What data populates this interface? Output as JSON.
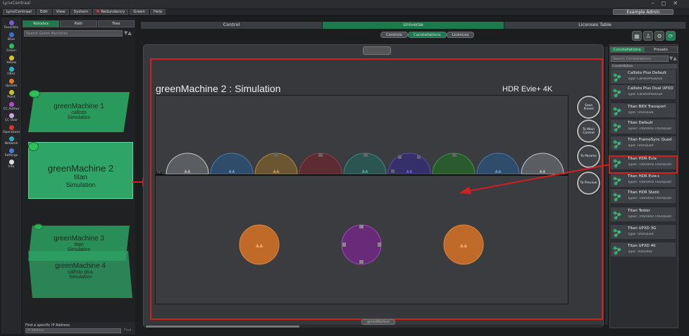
{
  "app": {
    "title": "LynxCentraal"
  },
  "menu": {
    "items": [
      "LynxCentraal",
      "Edit",
      "View",
      "System",
      "Redundancy",
      "Green",
      "Help"
    ],
    "user": "Example Admin"
  },
  "rail": {
    "items": [
      {
        "label": "Favorites",
        "color": "#7b5cd6"
      },
      {
        "label": "Blue",
        "color": "#3b6fd8"
      },
      {
        "label": "Green",
        "color": "#2ebd55"
      },
      {
        "label": "Yellow",
        "color": "#d9c42b"
      },
      {
        "label": "Filter",
        "color": "#2ab8c4"
      },
      {
        "label": "Update",
        "color": "#e07a2a"
      },
      {
        "label": "Point",
        "color": "#c6c62a"
      },
      {
        "label": "CC Author",
        "color": "#b04ad0"
      },
      {
        "label": "CC User",
        "color": "#c8a8e0"
      },
      {
        "label": "Operations",
        "color": "#e03030"
      },
      {
        "label": "Network",
        "color": "#2aa8c4"
      },
      {
        "label": "Settings",
        "color": "#4a7ad8"
      },
      {
        "label": "Info",
        "color": "#dddddd"
      }
    ]
  },
  "left": {
    "tabs": [
      "Rolodex",
      "Path",
      "Tree"
    ],
    "search_placeholder": "Search Green Machines",
    "machines": [
      {
        "name": "greenMachine 1",
        "sub1": "callisto",
        "sub2": "Simulation"
      },
      {
        "name": "greenMachine 2",
        "sub1": "titan",
        "sub2": "Simulation"
      },
      {
        "name": "greenMachine 3",
        "sub1": "titan",
        "sub2": "Simulation"
      },
      {
        "name": "greenMachine 4",
        "sub1": "callisto plus",
        "sub2": "Simulation"
      }
    ],
    "ip_label": "Find a specific IP Address",
    "ip_placeholder": "IP Address",
    "find": "Find"
  },
  "topnav": [
    "Control",
    "Universe",
    "Licenses Table"
  ],
  "subnav": [
    "Controls",
    "Constellations",
    "Licences"
  ],
  "stage": {
    "title": "greenMachine 2 : Simulation",
    "variant": "HDR Evie+ 4K",
    "buttons": [
      "Save Preset",
      "To Main Control",
      "To Params",
      "To Preview"
    ],
    "bin_label": "00",
    "bottom_label": "greenMachine"
  },
  "right": {
    "tabs": [
      "Constellations",
      "Presets"
    ],
    "search_placeholder": "Search Constellations",
    "header": "Constellation",
    "items": [
      {
        "name": "Callisto Plus Default",
        "type": "Type: CallistoPlusDual"
      },
      {
        "name": "Callisto Plus Dual UPXD",
        "type": "Type: CallistoPlusDual"
      },
      {
        "name": "Titan BIDI Transport",
        "type": "Type: TitanQuad"
      },
      {
        "name": "Titan Default",
        "type": "Types: TitanUHD TitanQuad"
      },
      {
        "name": "Titan FrameSync Quad",
        "type": "Type: TitanQuad"
      },
      {
        "name": "Titan HDR Evie",
        "type": "Types: TitanUHD TitanQuad"
      },
      {
        "name": "Titan HDR Evie+",
        "type": "Types: TitanUHD TitanQuad"
      },
      {
        "name": "Titan HDR Static",
        "type": "Types: TitanUHD TitanQuad"
      },
      {
        "name": "Titan Tester",
        "type": "Types: TitanUHD TitanQuad"
      },
      {
        "name": "Titan UPXD 3G",
        "type": "Type: TitanQuad"
      },
      {
        "name": "Titan UPXD 4K",
        "type": "Type: TitanUHD"
      }
    ]
  }
}
